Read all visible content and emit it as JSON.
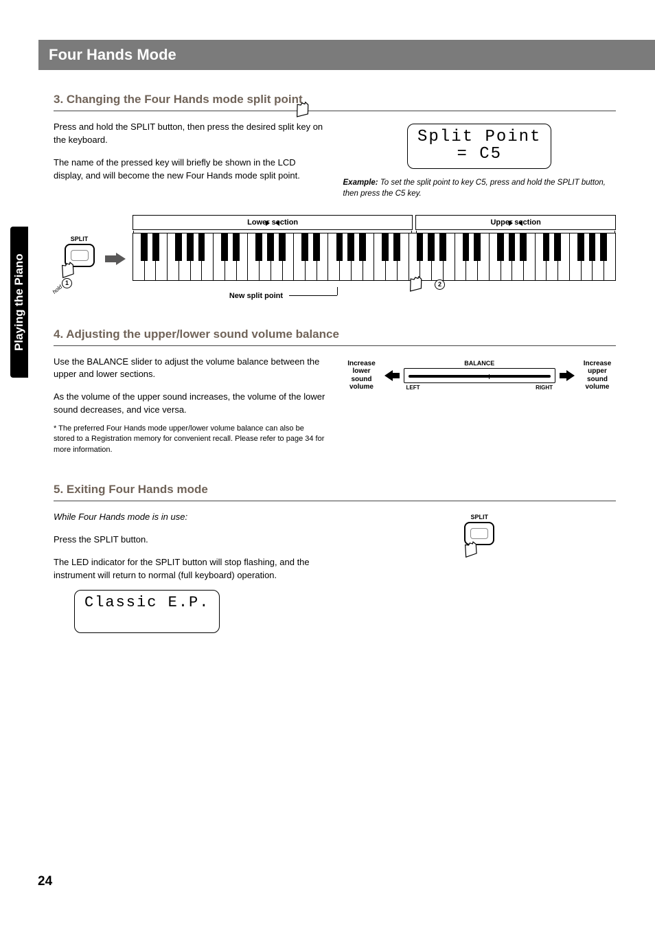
{
  "header": {
    "title": "Four Hands Mode"
  },
  "sidebar": {
    "tab": "Playing the Piano"
  },
  "page_number": "24",
  "section3": {
    "heading": "3. Changing the Four Hands mode split point",
    "p1": "Press and hold the SPLIT button, then press the desired split key on the keyboard.",
    "p2": "The name of the pressed key will briefly be shown in the LCD display, and will become the new Four Hands mode split point.",
    "lcd_line1": "Split Point",
    "lcd_line2": "= C5",
    "example_label": "Example:",
    "example_text": " To set the split point to key C5, press and hold the SPLIT button, then press the C5 key.",
    "diagram": {
      "split_label": "SPLIT",
      "hold": "hold",
      "step1": "1",
      "step2": "2",
      "lower": "Lower section",
      "upper": "Upper section",
      "new_split": "New split point"
    }
  },
  "section4": {
    "heading": "4. Adjusting the upper/lower sound volume balance",
    "p1": "Use the BALANCE slider to adjust the volume balance between the upper and lower sections.",
    "p2": "As the volume of the upper sound increases, the volume of the lower sound decreases, and vice versa.",
    "footnote": "* The preferred Four Hands mode upper/lower volume balance can also be stored to a Registration memory for convenient recall.  Please refer to page 34 for more information.",
    "diagram": {
      "title": "BALANCE",
      "left_label": "Increase lower sound volume",
      "right_label": "Increase upper sound volume",
      "left_tag": "LEFT",
      "right_tag": "RIGHT"
    }
  },
  "section5": {
    "heading": "5. Exiting Four Hands mode",
    "intro": "While Four Hands mode is in use:",
    "p1": "Press the SPLIT button.",
    "p2": "The LED indicator for the SPLIT button will stop flashing, and the instrument will return to normal (full keyboard) operation.",
    "lcd": "Classic E.P.",
    "split_label": "SPLIT"
  }
}
